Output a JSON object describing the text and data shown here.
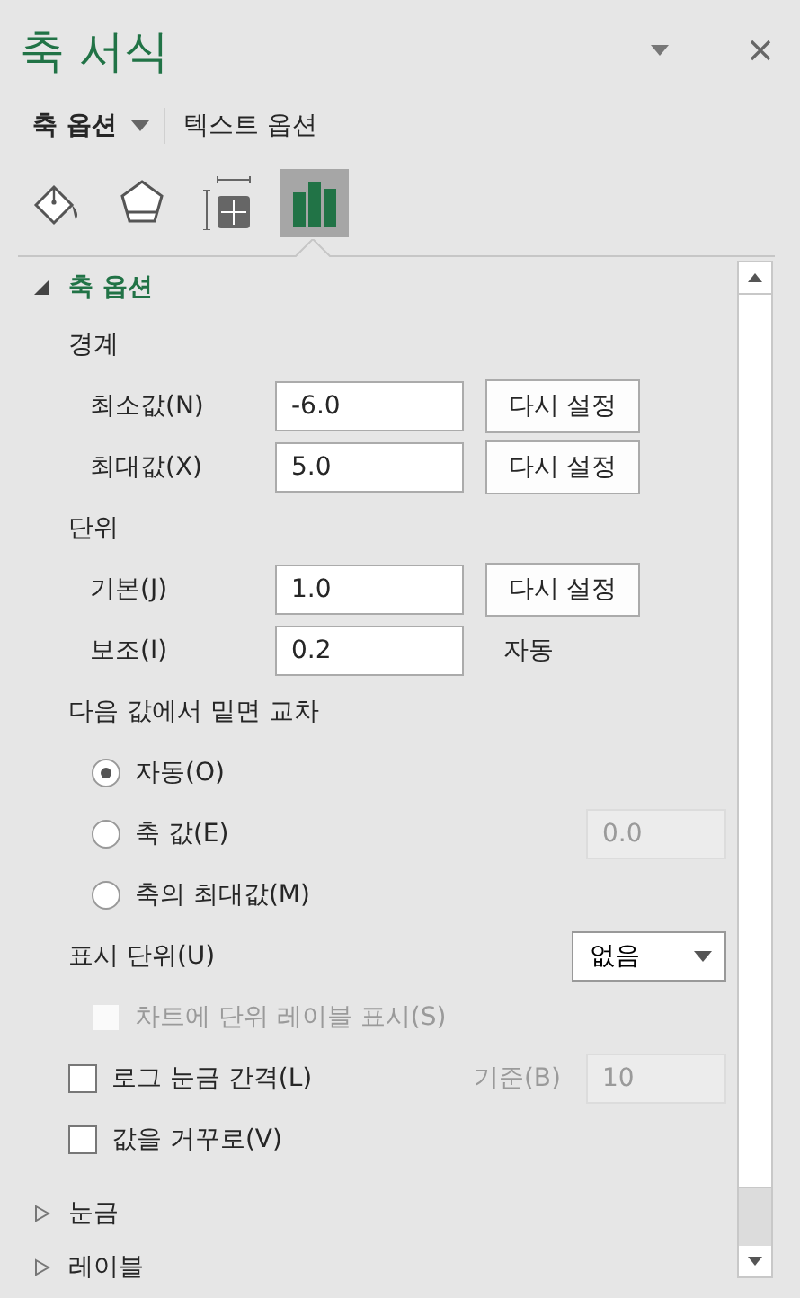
{
  "pane": {
    "title": "축 서식"
  },
  "option_tabs": [
    {
      "label": "축 옵션",
      "selected": true,
      "dropdown": true
    },
    {
      "label": "텍스트 옵션",
      "selected": false,
      "dropdown": false
    }
  ],
  "icon_tabs": [
    {
      "kind": "fill",
      "selected": false
    },
    {
      "kind": "effects",
      "selected": false
    },
    {
      "kind": "size",
      "selected": false
    },
    {
      "kind": "options",
      "selected": true
    }
  ],
  "sections": [
    {
      "title": "축 옵션",
      "expanded": true,
      "rows": [
        {
          "kind": "heading",
          "label": "경계"
        },
        {
          "kind": "field",
          "label": "최소값(N)",
          "value": "-6.0",
          "button": "다시 설정"
        },
        {
          "kind": "field",
          "label": "최대값(X)",
          "value": "5.0",
          "button": "다시 설정"
        },
        {
          "kind": "heading",
          "label": "단위"
        },
        {
          "kind": "field",
          "label": "기본(J)",
          "value": "1.0",
          "button": "다시 설정"
        },
        {
          "kind": "field",
          "label": "보조(I)",
          "value": "0.2",
          "note": "자동"
        },
        {
          "kind": "heading",
          "label": "다음 값에서 밑면 교차"
        },
        {
          "kind": "radio",
          "label": "자동(O)",
          "selected": true
        },
        {
          "kind": "radio",
          "label": "축 값(E)",
          "selected": false,
          "value": "0.0",
          "field_disabled": true
        },
        {
          "kind": "radio",
          "label": "축의 최대값(M)",
          "selected": false
        },
        {
          "kind": "dropdown",
          "label": "표시 단위(U)",
          "value": "없음"
        },
        {
          "kind": "sub_checkbox",
          "label": "차트에 단위 레이블 표시(S)",
          "checked": false,
          "disabled": true
        },
        {
          "kind": "checkbox",
          "label": "로그 눈금 간격(L)",
          "checked": false,
          "disabled": false,
          "side_label": "기준(B)",
          "value": "10",
          "field_disabled": true
        },
        {
          "kind": "checkbox",
          "label": "값을 거꾸로(V)",
          "checked": false,
          "disabled": false
        }
      ]
    },
    {
      "title": "눈금",
      "expanded": false
    },
    {
      "title": "레이블",
      "expanded": false
    }
  ]
}
